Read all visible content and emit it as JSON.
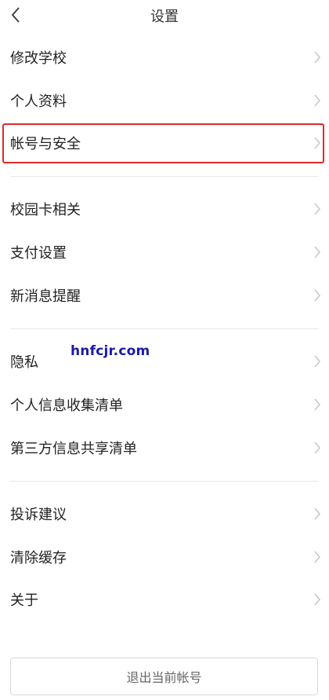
{
  "header": {
    "title": "设置",
    "back_icon": "chevron-left-icon"
  },
  "groups": [
    {
      "items": [
        {
          "label": "修改学校"
        },
        {
          "label": "个人资料"
        },
        {
          "label": "帐号与安全",
          "highlighted": true
        }
      ]
    },
    {
      "items": [
        {
          "label": "校园卡相关"
        },
        {
          "label": "支付设置"
        },
        {
          "label": "新消息提醒"
        }
      ]
    },
    {
      "items": [
        {
          "label": "隐私"
        },
        {
          "label": "个人信息收集清单"
        },
        {
          "label": "第三方信息共享清单"
        }
      ]
    },
    {
      "items": [
        {
          "label": "投诉建议"
        },
        {
          "label": "清除缓存"
        },
        {
          "label": "关于"
        }
      ]
    }
  ],
  "logout": {
    "label": "退出当前帐号"
  },
  "watermark": "hnfcjr.com",
  "colors": {
    "highlight_border": "#e02a2a",
    "chevron": "#c8c8c8",
    "watermark": "#1a1aa8"
  }
}
